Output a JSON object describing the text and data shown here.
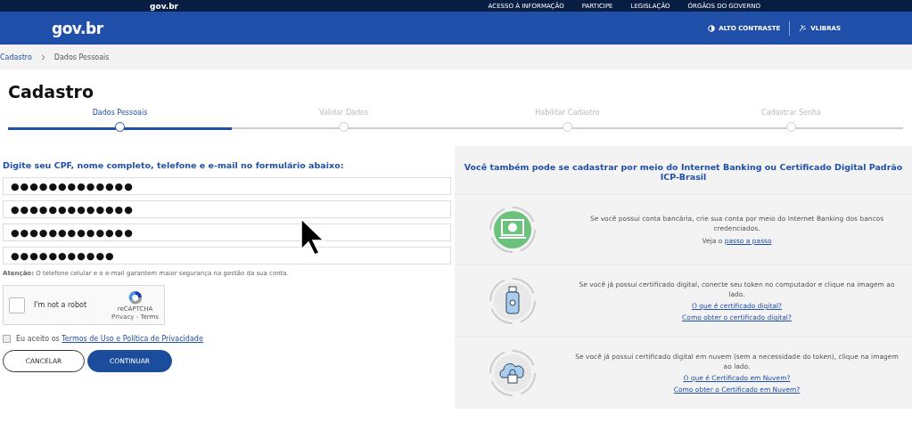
{
  "top_bar": {
    "logo": "gov.br",
    "links": [
      "ACESSO À INFORMAÇÃO",
      "PARTICIPE",
      "LEGISLAÇÃO",
      "ÓRGÃOS DO GOVERNO"
    ]
  },
  "header": {
    "logo": "gov.br",
    "actions": [
      "ALTO CONTRASTE",
      "VLIBRAS"
    ]
  },
  "breadcrumb": [
    "Cadastro",
    "Dados Pessoais"
  ],
  "title": "Cadastro",
  "steps": [
    {
      "label": "Dados Pessoais",
      "selected": true
    },
    {
      "label": "Validar Dados",
      "selected": false
    },
    {
      "label": "Habilitar Cadastro",
      "selected": false
    },
    {
      "label": "Cadastrar Senha",
      "selected": false
    }
  ],
  "form": {
    "heading": "Digite seu CPF, nome completo, telefone e e-mail no formulário abaixo:",
    "fields": [
      {
        "value": "●●●●●●●●●●●●●"
      },
      {
        "value": "●●●●●●●●●●●●●"
      },
      {
        "value": "●●●●●●●●●●●●●"
      },
      {
        "value": "●●●●●●●●●●●"
      }
    ],
    "notice": "**Atenção:** O telefone celular e o e-mail garantem maior segurança na gestão da sua conta.",
    "captcha": {
      "label": "I'm not a robot",
      "brand": "reCAPTCHA",
      "links": "Privacy - Terms",
      "checked": false
    },
    "terms": {
      "text": "Eu aceito os",
      "link": "Termos de Uso e Política de Privacidade",
      "checked": false
    },
    "buttons": [
      {
        "label": "CANCELAR",
        "kind": "outline"
      },
      {
        "label": "CONTINUAR",
        "kind": "primary"
      }
    ]
  },
  "alternatives": {
    "heading": "Você também pode se cadastrar por meio do Internet Banking ou Certificado Digital Padrão ICP-Brasil",
    "options": [
      {
        "kind": "bank",
        "text": "Se você possui conta bancária, crie sua conta por meio do Internet Banking dos bancos credenciados.",
        "prefix": "Veja o",
        "links": [
          "passo a passo"
        ]
      },
      {
        "kind": "token",
        "text": "Se você já possui certificado digital, conecte seu token no computador e clique na imagem ao lado.",
        "links": [
          "O que é certificado digital?",
          "Como obter o certificado digital?"
        ]
      },
      {
        "kind": "cloud",
        "text": "Se você já possui certificado digital em nuvem (sem a necessidade do token), clique na imagem ao lado.",
        "links": [
          "O que é Certificado em Nuvem?",
          "Como obter o Certificado em Nuvem?"
        ]
      }
    ]
  }
}
